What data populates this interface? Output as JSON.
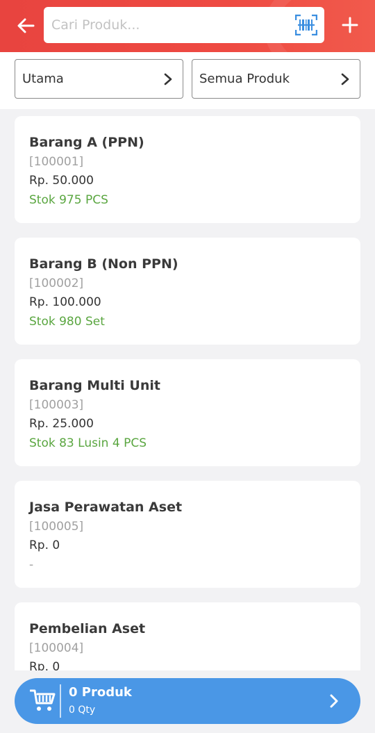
{
  "header": {
    "search_placeholder": "Cari Produk...",
    "background": "#ee4a42",
    "icons": [
      "back-arrow-icon",
      "barcode-scan-icon",
      "plus-icon"
    ]
  },
  "filters": {
    "category_label": "Utama",
    "product_filter_label": "Semua Produk"
  },
  "products": [
    {
      "name": "Barang A (PPN)",
      "code": "[100001]",
      "price": "Rp. 50.000",
      "stock": "Stok 975 PCS"
    },
    {
      "name": "Barang B (Non PPN)",
      "code": "[100002]",
      "price": "Rp. 100.000",
      "stock": "Stok 980 Set"
    },
    {
      "name": "Barang Multi Unit",
      "code": "[100003]",
      "price": "Rp. 25.000",
      "stock": "Stok 83 Lusin 4 PCS"
    },
    {
      "name": "Jasa Perawatan Aset",
      "code": "[100005]",
      "price": "Rp. 0",
      "stock": "-"
    },
    {
      "name": "Pembelian Aset",
      "code": "[100004]",
      "price": "Rp. 0",
      "stock": ""
    }
  ],
  "cart": {
    "count_label": "0 Produk",
    "qty_label": "0 Qty",
    "color": "#4a97e6"
  },
  "colors": {
    "stock_green": "#5aa640",
    "accent_red": "#ee4a42"
  }
}
